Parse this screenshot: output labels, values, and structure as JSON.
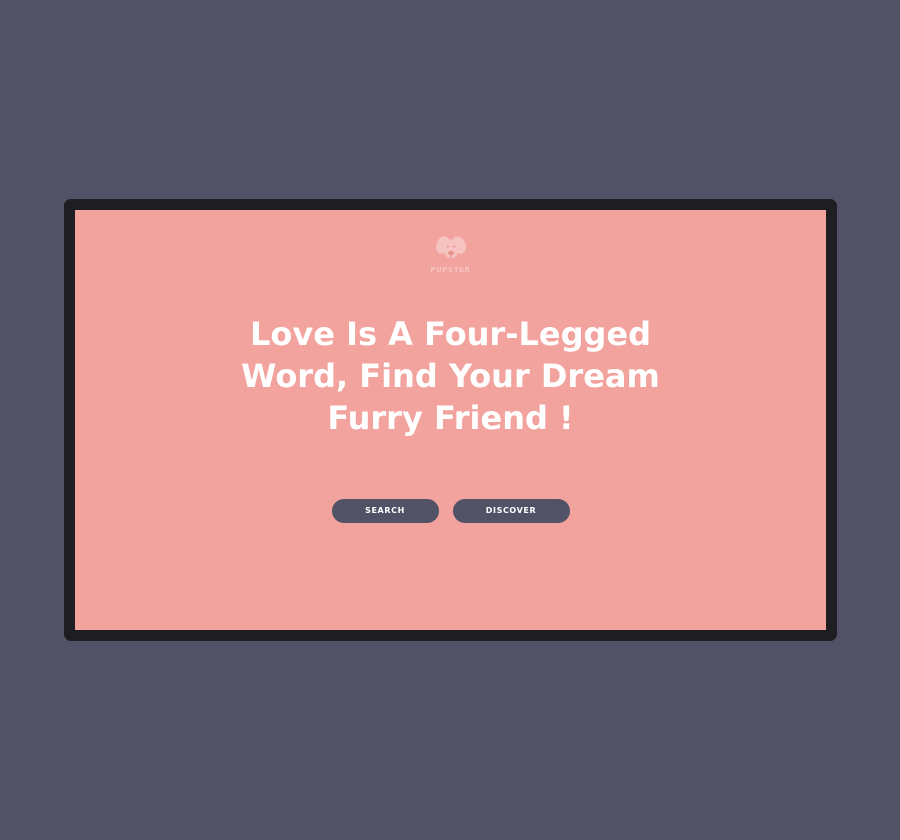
{
  "brand": {
    "name": "PUPSTER",
    "logo_icon": "dog-face-icon",
    "logo_color": "#f6c3c0"
  },
  "hero": {
    "title": "Love Is A Four-Legged Word, Find Your Dream Furry Friend !"
  },
  "actions": {
    "search_label": "SEARCH",
    "discover_label": "DISCOVER"
  },
  "colors": {
    "background": "#525266",
    "frame": "#1e1d21",
    "screen": "#f2a39e",
    "button": "#525266",
    "text": "#ffffff"
  }
}
